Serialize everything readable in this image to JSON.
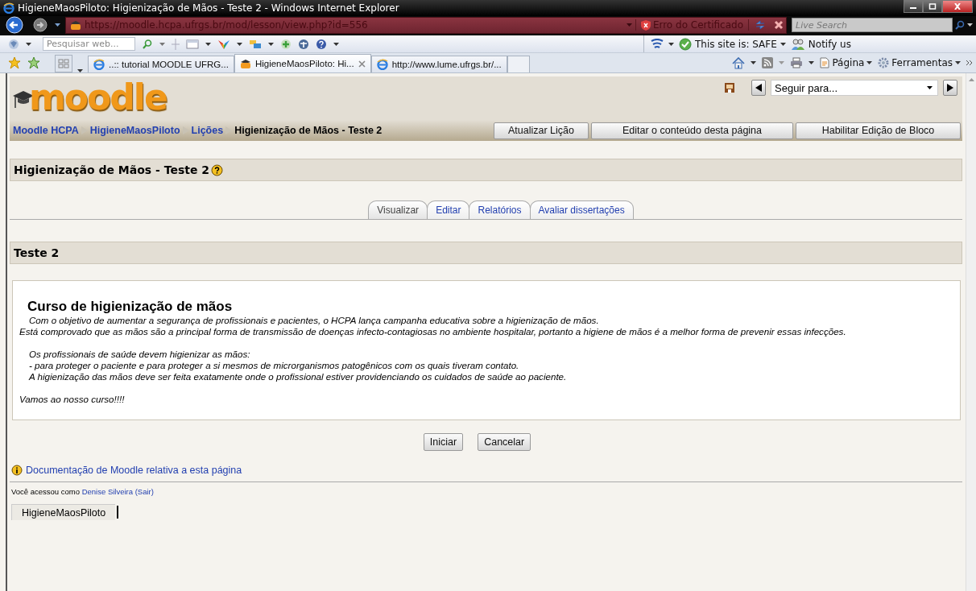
{
  "window": {
    "title": "HigieneMaosPiloto: Higienização de Mãos - Teste 2 - Windows Internet Explorer"
  },
  "address_bar": {
    "url": "https://moodle.hcpa.ufrgs.br/mod/lesson/view.php?id=556",
    "certificate_error": "Erro do Certificado",
    "search_placeholder": "Live Search"
  },
  "toolbar": {
    "search_placeholder": "Pesquisar web...",
    "site_status": "This site is: SAFE",
    "notify": "Notify us"
  },
  "browser_tabs": [
    {
      "label": "..:: tutorial MOODLE UFRG...",
      "selected": false
    },
    {
      "label": "HigieneMaosPiloto: Hi...",
      "selected": true
    },
    {
      "label": "http://www.lume.ufrgs.br/...",
      "selected": false
    }
  ],
  "command_bar": [
    "Página",
    "Ferramentas"
  ],
  "page": {
    "logo": "moodle",
    "jump_placeholder": "Seguir para...",
    "breadcrumbs": [
      {
        "label": "Moodle HCPA",
        "kind": "link"
      },
      {
        "label": "HigieneMaosPiloto",
        "kind": "link"
      },
      {
        "label": "Lições",
        "kind": "link"
      },
      {
        "label": "Higienização de Mãos - Teste 2",
        "kind": "current"
      }
    ],
    "header_buttons": [
      "Atualizar Lição",
      "Editar o conteúdo desta página",
      "Habilitar Edição de Bloco"
    ],
    "heading": "Higienização de Mãos - Teste 2",
    "tabs": [
      {
        "label": "Visualizar",
        "selected": true
      },
      {
        "label": "Editar",
        "selected": false
      },
      {
        "label": "Relatórios",
        "selected": false
      },
      {
        "label": "Avaliar dissertações",
        "selected": false
      }
    ],
    "section_title": "Teste 2",
    "content": {
      "title": "Curso de higienização de mãos",
      "paragraphs": [
        [
          {
            "text": "Com o objetivo de aumentar a segurança de profissionais e pacientes, o HCPA lança campanha educativa sobre a higienização de mãos.",
            "indent": true
          },
          {
            "text": "Está comprovado que as mãos são a principal forma de transmissão de doenças infecto-contagiosas no ambiente hospitalar, portanto a higiene de mãos é a melhor forma de prevenir essas infecções.",
            "indent": false
          }
        ],
        [
          {
            "text": "Os profissionais de saúde devem higienizar as mãos:",
            "indent": true
          },
          {
            "text": "- para proteger o paciente e para proteger a si mesmos de microrganismos patogênicos com os quais tiveram contato.",
            "indent": true
          },
          {
            "text": "A higienização das mãos deve ser feita exatamente onde o profissional estiver providenciando os cuidados de saúde ao paciente.",
            "indent": true
          }
        ],
        [
          {
            "text": "Vamos ao nosso curso!!!!",
            "indent": false
          }
        ]
      ]
    },
    "buttons": [
      "Iniciar",
      "Cancelar"
    ],
    "doc_link": "Documentação de Moodle relativa a esta página",
    "login": {
      "prefix": "Você acessou como",
      "user": "Denise Silveira",
      "logout": "(Sair)"
    },
    "footer_tab": "HigieneMaosPiloto"
  }
}
